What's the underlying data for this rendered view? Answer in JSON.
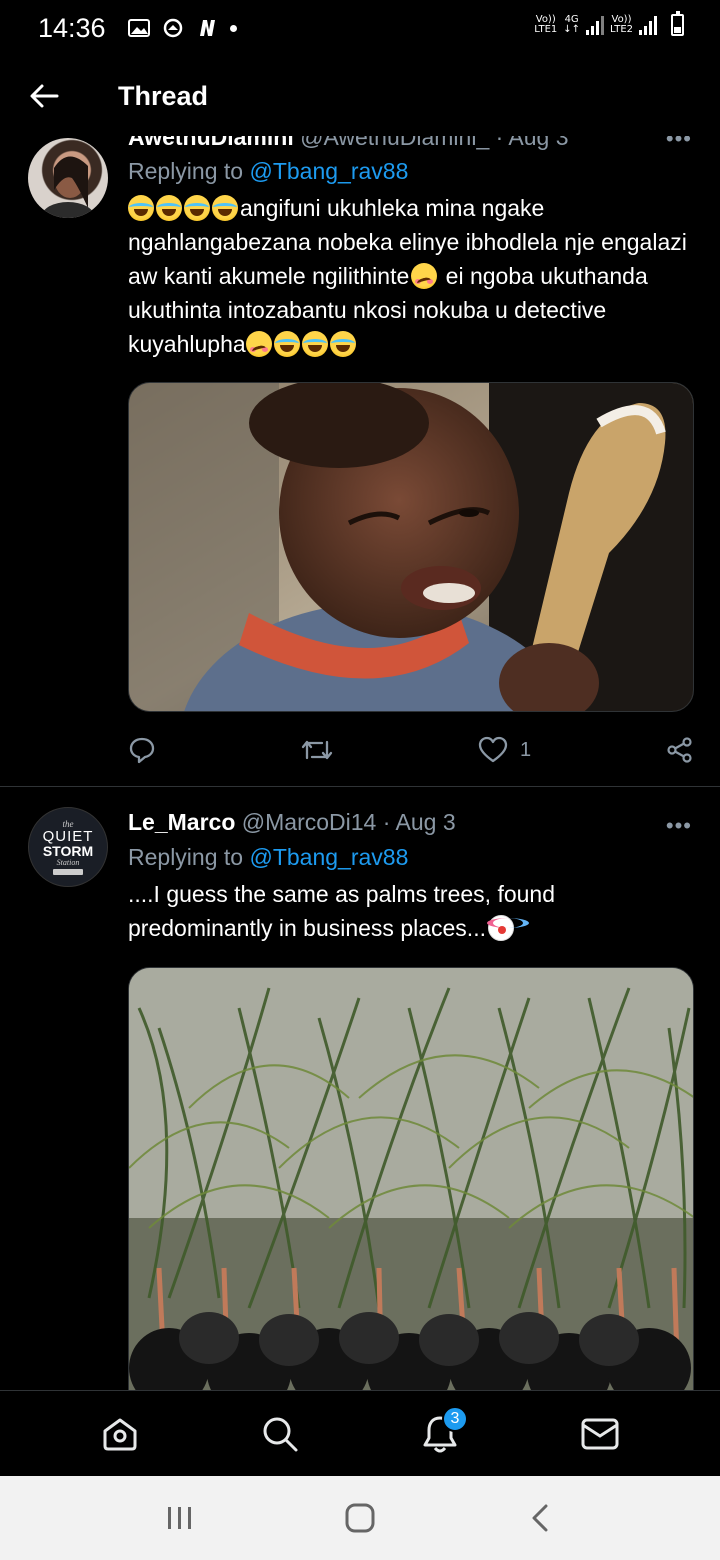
{
  "status_bar": {
    "time": "14:36",
    "sim1_label_top": "Vo))",
    "sim1_label_bottom": "LTE1",
    "net_label_top": "4G",
    "net_label_bottom": "↓↑",
    "sim2_label_top": "Vo))",
    "sim2_label_bottom": "LTE2"
  },
  "header": {
    "title": "Thread"
  },
  "tweets": [
    {
      "name": "AwethuDlamini",
      "handle": "@AwethuDlamini_",
      "date": "Aug 3",
      "replying_prefix": "Replying to ",
      "replying_to": "@Tbang_rav88",
      "text_part1": "angifuni ukuhleka mina ngake ngahlangabezana nobeka elinye ibhodlela nje engalazi aw kanti akumele ngilithinte",
      "text_part2": " ei ngoba ukuthanda ukuthinta intozabantu nkosi nokuba u detective kuyahlupha",
      "likes": "1"
    },
    {
      "name": "Le_Marco",
      "handle": "@MarcoDi14",
      "date": "Aug 3",
      "separator": " · ",
      "replying_prefix": "Replying to ",
      "replying_to": "@Tbang_rav88",
      "text": "....I guess the same as palms trees, found predominantly in business places...",
      "avatar_text_top": "the",
      "avatar_text_mid1": "QUIET",
      "avatar_text_mid2": "STORM",
      "avatar_text_bottom": "Station"
    }
  ],
  "bottom_nav": {
    "notification_count": "3"
  },
  "colors": {
    "accent": "#1d9bf0",
    "background": "#000000",
    "muted": "#8b98a5"
  }
}
